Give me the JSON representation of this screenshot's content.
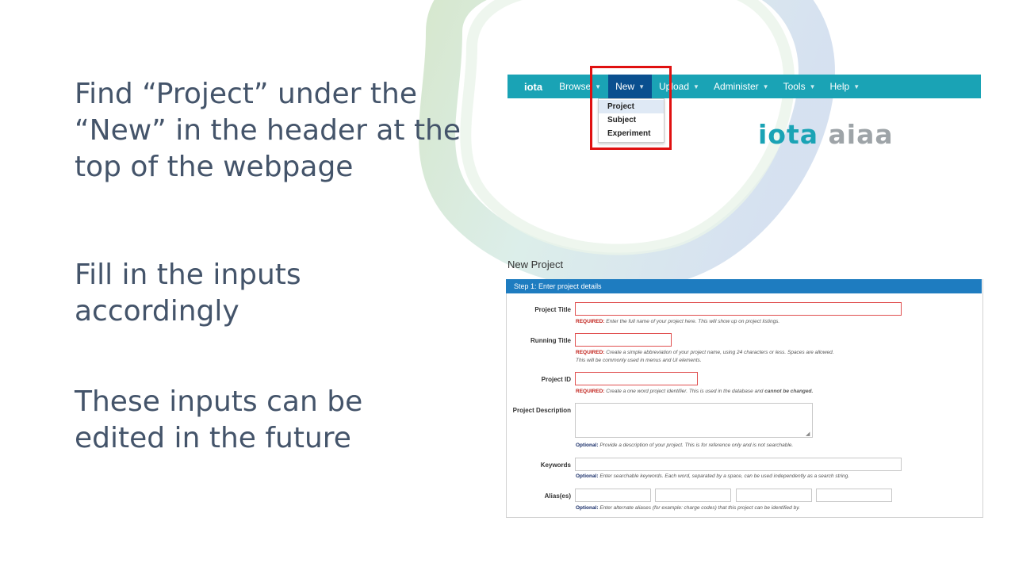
{
  "slide": {
    "instruction_1": "Find “Project” under the “New” in the header at the top of the webpage",
    "instruction_2": "Fill in the inputs accordingly",
    "instruction_3": "These inputs can be edited in the future",
    "accent_color": "#44546a"
  },
  "navbar": {
    "brand": "iota",
    "items": [
      {
        "label": "Browse",
        "has_caret": true
      },
      {
        "label": "New",
        "has_caret": true,
        "active": true
      },
      {
        "label": "Upload",
        "has_caret": true
      },
      {
        "label": "Administer",
        "has_caret": true
      },
      {
        "label": "Tools",
        "has_caret": true
      },
      {
        "label": "Help",
        "has_caret": true
      }
    ],
    "color": "#1aa3b5",
    "active_color": "#0a4f8f",
    "dropdown": [
      {
        "label": "Project"
      },
      {
        "label": "Subject"
      },
      {
        "label": "Experiment"
      }
    ]
  },
  "logo": {
    "part1": "iota",
    "part2": "aiaa"
  },
  "form": {
    "page_title": "New Project",
    "step_label": "Step 1: Enter project details",
    "fields": {
      "project_title": {
        "label": "Project Title",
        "tag": "REQUIRED:",
        "help": "Enter the full name of your project here. This will show up on project listings."
      },
      "running_title": {
        "label": "Running Title",
        "tag": "REQUIRED:",
        "help": "Create a simple abbreviation of your project name, using 24 characters or less. Spaces are allowed.",
        "help2": "This will be commonly used in menus and UI elements."
      },
      "project_id": {
        "label": "Project ID",
        "tag": "REQUIRED:",
        "help": "Create a one word project identifier. This is used in the database and",
        "help_emphasis": "cannot be changed."
      },
      "project_description": {
        "label": "Project Description",
        "tag": "Optional:",
        "help": "Provide a description of your project. This is for reference only and is not searchable."
      },
      "keywords": {
        "label": "Keywords",
        "tag": "Optional:",
        "help": "Enter searchable keywords. Each word, separated by a space, can be used independently as a search string."
      },
      "aliases": {
        "label": "Alias(es)",
        "tag": "Optional:",
        "help": "Enter alternate aliases (for example: charge codes) that this project can be identified by."
      }
    },
    "header_color": "#1e7cc0"
  }
}
